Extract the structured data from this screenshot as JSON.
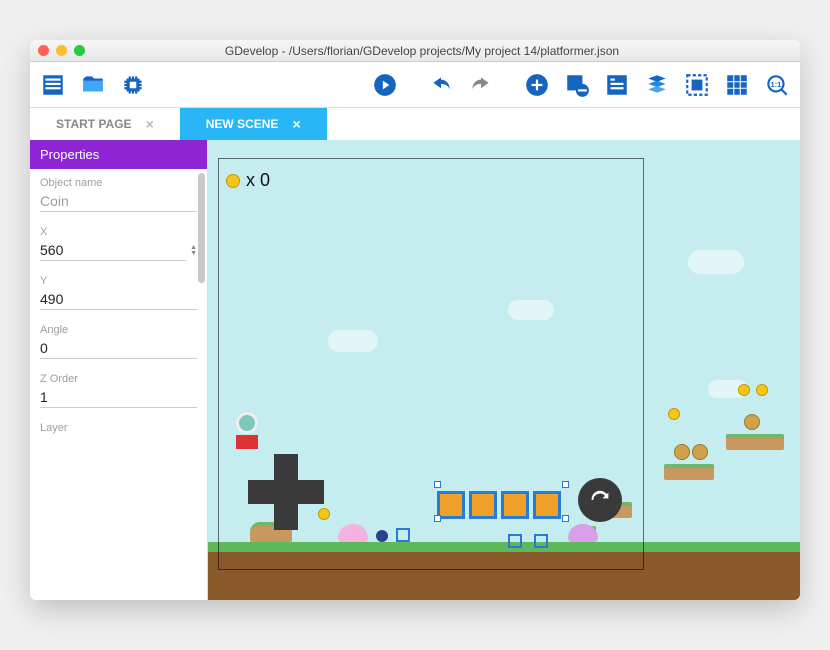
{
  "window": {
    "title": "GDevelop - /Users/florian/GDevelop projects/My project 14/platformer.json"
  },
  "toolbar": {
    "icons": [
      "project-manager",
      "open",
      "chip",
      "play",
      "undo",
      "redo",
      "add-object",
      "minus",
      "properties",
      "layers",
      "instances",
      "grid",
      "zoom-reset"
    ]
  },
  "tabs": [
    {
      "label": "START PAGE",
      "active": false,
      "closable": true
    },
    {
      "label": "NEW SCENE",
      "active": true,
      "closable": true
    }
  ],
  "panel": {
    "title": "Properties",
    "fields": {
      "object_name_label": "Object name",
      "object_name": "Coin",
      "x_label": "X",
      "x": "560",
      "y_label": "Y",
      "y": "490",
      "angle_label": "Angle",
      "angle": "0",
      "z_label": "Z Order",
      "z": "1",
      "layer_label": "Layer"
    }
  },
  "scene": {
    "counter": "x 0"
  },
  "colors": {
    "accent": "#29b6f6",
    "panel": "#8e24d4",
    "icon": "#1565c0"
  }
}
